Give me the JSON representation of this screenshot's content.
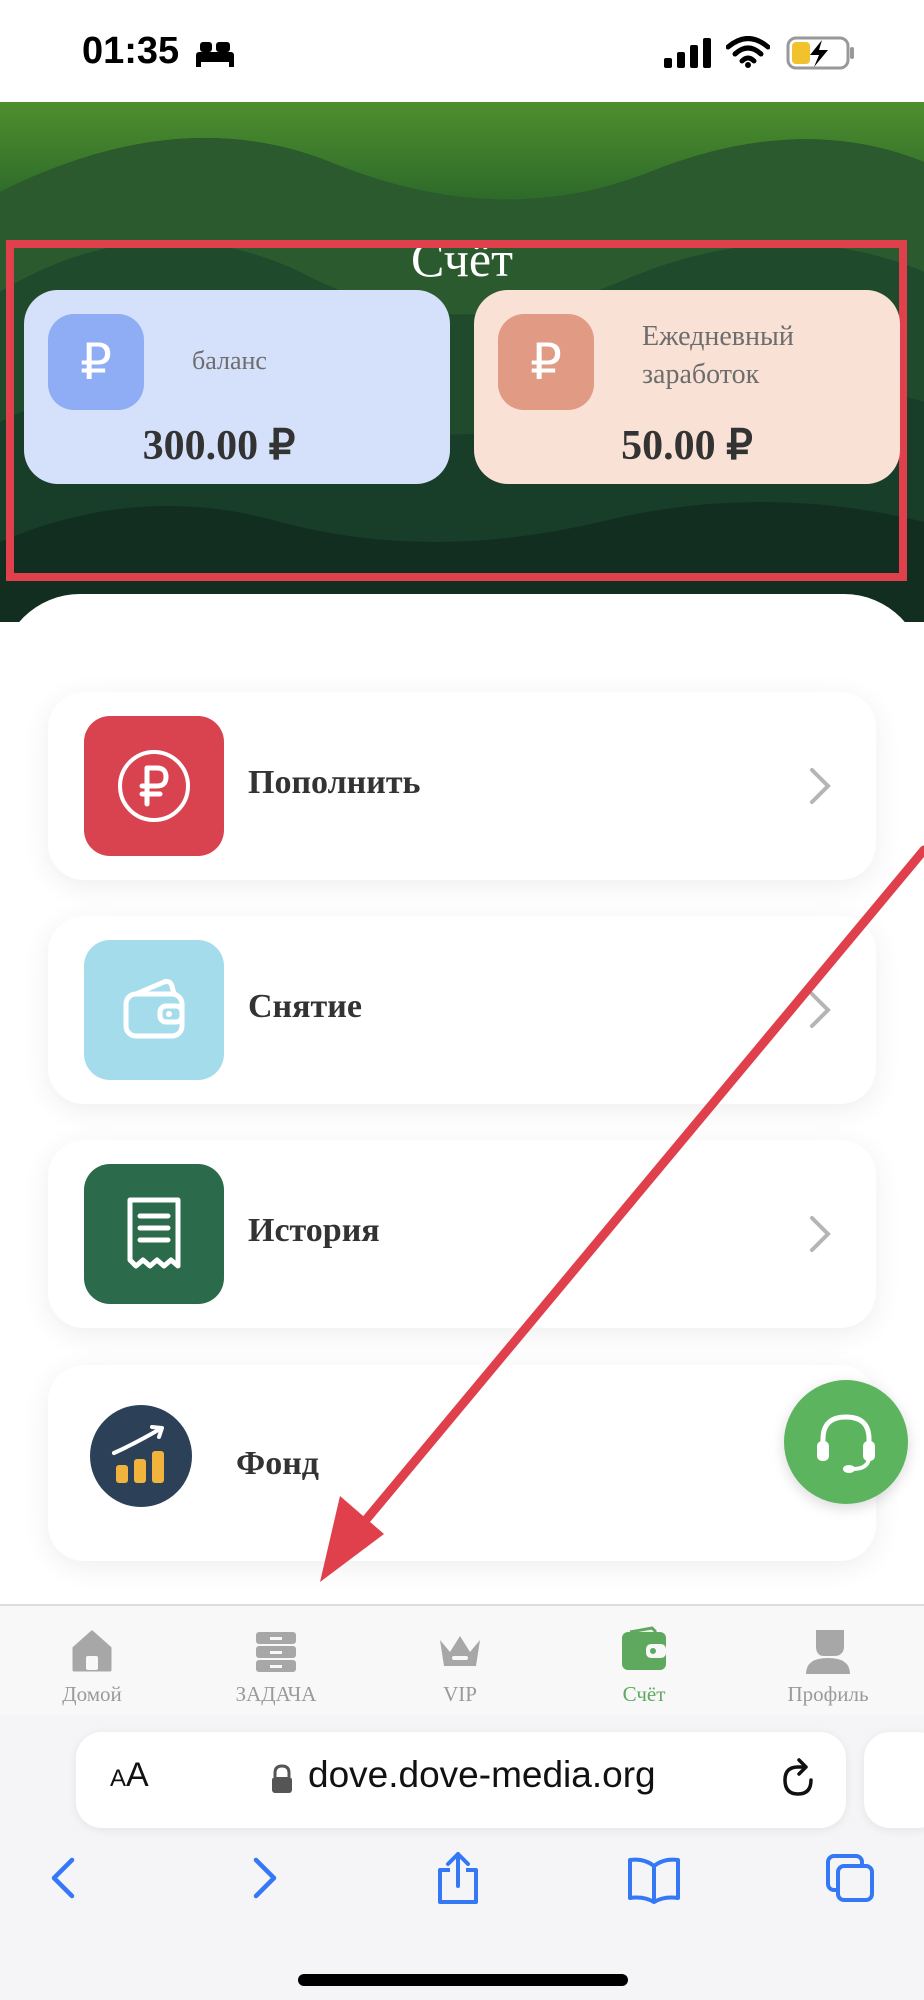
{
  "status_bar": {
    "time": "01:35",
    "icons": [
      "bed-icon",
      "signal-icon",
      "wifi-icon",
      "battery-charging-icon"
    ]
  },
  "header": {
    "title": "Счёт"
  },
  "cards": [
    {
      "label": "баланс",
      "value": "300.00 ₽",
      "icon": "ruble-icon",
      "icon_glyph": "₽"
    },
    {
      "label_line1": "Ежедневный",
      "label_line2": "заработок",
      "value": "50.00 ₽",
      "icon": "ruble-icon",
      "icon_glyph": "₽"
    }
  ],
  "menu": [
    {
      "label": "Пополнить",
      "icon": "ruble-circle-icon",
      "color": "#d9434f"
    },
    {
      "label": "Снятие",
      "icon": "wallet-icon",
      "color": "#a5dcec"
    },
    {
      "label": "История",
      "icon": "receipt-icon",
      "color": "#2b6a4a"
    },
    {
      "label": "Фонд",
      "icon": "growth-chart-icon",
      "color": "#2c4157"
    }
  ],
  "tab_bar": {
    "tabs": [
      {
        "label": "Домой",
        "icon": "home-icon",
        "active": false
      },
      {
        "label": "ЗАДАЧА",
        "icon": "tasks-icon",
        "active": false
      },
      {
        "label": "VIP",
        "icon": "crown-icon",
        "active": false
      },
      {
        "label": "Счёт",
        "icon": "wallet-tab-icon",
        "active": true
      },
      {
        "label": "Профиль",
        "icon": "profile-icon",
        "active": false
      }
    ]
  },
  "browser": {
    "text_size_small": "A",
    "text_size_large": "A",
    "url": "dove.dove-media.org"
  },
  "colors": {
    "accent_green": "#5fa95f",
    "highlight_red": "#e0404c",
    "header_dark": "#12321f"
  }
}
